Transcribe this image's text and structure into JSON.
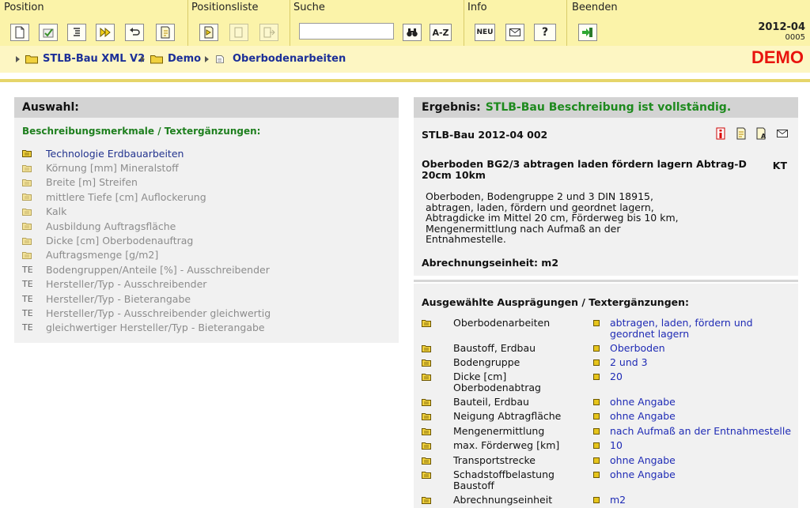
{
  "toolbar": {
    "groups": {
      "position": "Position",
      "positionsliste": "Positionsliste",
      "suche": "Suche",
      "info": "Info",
      "beenden": "Beenden"
    },
    "search": {
      "value": "",
      "placeholder": ""
    },
    "az_label": "A-Z",
    "neu_label": "NEU",
    "help_label": "?",
    "version": "2012-04",
    "version_sub": "0005"
  },
  "breadcrumb": {
    "items": [
      "STLB-Bau XML V2",
      "Demo",
      "Oberbodenarbeiten"
    ]
  },
  "demo_label": "DEMO",
  "left_panel": {
    "title": "Auswahl:",
    "subtitle": "Beschreibungsmerkmale / Textergänzungen:",
    "items": [
      {
        "label": "Technologie Erdbauarbeiten",
        "icon": "folder-icon",
        "active": true
      },
      {
        "label": "Körnung [mm] Mineralstoff",
        "icon": "folder-icon",
        "active": false
      },
      {
        "label": "Breite [m] Streifen",
        "icon": "folder-icon",
        "active": false
      },
      {
        "label": "mittlere Tiefe [cm] Auflockerung",
        "icon": "folder-icon",
        "active": false
      },
      {
        "label": "Kalk",
        "icon": "folder-icon",
        "active": false
      },
      {
        "label": "Ausbildung Auftragsfläche",
        "icon": "folder-icon",
        "active": false
      },
      {
        "label": "Dicke [cm] Oberbodenauftrag",
        "icon": "folder-icon",
        "active": false
      },
      {
        "label": "Auftragsmenge [g/m2]",
        "icon": "folder-icon",
        "active": false
      },
      {
        "label": "Bodengruppen/Anteile [%] - Ausschreibender",
        "icon": "TE",
        "active": false
      },
      {
        "label": "Hersteller/Typ - Ausschreibender",
        "icon": "TE",
        "active": false
      },
      {
        "label": "Hersteller/Typ - Bieterangabe",
        "icon": "TE",
        "active": false
      },
      {
        "label": "Hersteller/Typ - Ausschreibender gleichwertig",
        "icon": "TE",
        "active": false
      },
      {
        "label": "gleichwertiger Hersteller/Typ - Bieterangabe",
        "icon": "TE",
        "active": false
      }
    ]
  },
  "result": {
    "label": "Ergebnis:",
    "status": "STLB-Bau Beschreibung ist vollständig.",
    "code": "STLB-Bau 2012-04 002",
    "short_text": "Oberboden BG2/3 abtragen laden fördern lagern Abtrag-D 20cm 10km",
    "kt": "KT",
    "long_text": "Oberboden, Bodengruppe 2 und 3 DIN 18915, abtragen, laden, fördern und geordnet lagern, Abtragdicke im Mittel 20 cm, Förderweg bis 10 km, Mengenermittlung nach Aufmaß an der Entnahmestelle.",
    "unit_line": "Abrechnungseinheit: m2"
  },
  "selected": {
    "title": "Ausgewählte Ausprägungen / Textergänzungen:",
    "rows": [
      {
        "label": "Oberbodenarbeiten",
        "value": "abtragen, laden, fördern und geordnet lagern"
      },
      {
        "label": "Baustoff, Erdbau",
        "value": "Oberboden"
      },
      {
        "label": "Bodengruppe",
        "value": "2 und 3"
      },
      {
        "label": "Dicke [cm] Oberbodenabtrag",
        "value": "20"
      },
      {
        "label": "Bauteil, Erdbau",
        "value": "ohne Angabe"
      },
      {
        "label": "Neigung Abtragfläche",
        "value": "ohne Angabe"
      },
      {
        "label": "Mengenermittlung",
        "value": "nach Aufmaß an der Entnahmestelle"
      },
      {
        "label": "max. Förderweg [km]",
        "value": "10"
      },
      {
        "label": "Transportstrecke",
        "value": "ohne Angabe"
      },
      {
        "label": "Schadstoffbelastung Baustoff",
        "value": "ohne Angabe"
      },
      {
        "label": "Abrechnungseinheit",
        "value": "m2"
      }
    ]
  }
}
